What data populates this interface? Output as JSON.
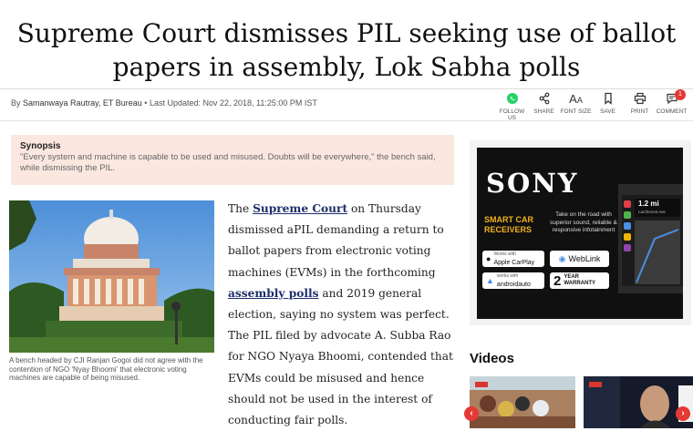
{
  "headline": {
    "line1": "Supreme Court dismisses PIL seeking use of ballot",
    "line2": "papers in assembly, Lok Sabha polls"
  },
  "byline": {
    "prefix": "By",
    "author": "Samanwaya Rautray, ET Bureau",
    "separator": "•",
    "updated": "Last Updated: Nov 22, 2018, 11:25:00 PM IST"
  },
  "actions": [
    {
      "label": "FOLLOW US",
      "icon": "whatsapp-icon"
    },
    {
      "label": "SHARE",
      "icon": "share-icon"
    },
    {
      "label": "FONT SIZE",
      "icon": "font-size-icon"
    },
    {
      "label": "SAVE",
      "icon": "bookmark-icon"
    },
    {
      "label": "PRINT",
      "icon": "print-icon"
    },
    {
      "label": "COMMENT",
      "icon": "comment-icon",
      "badge": "1"
    }
  ],
  "synopsis": {
    "title": "Synopsis",
    "text": "\"Every system and machine is capable to be used and misused. Doubts will be everywhere,\" the bench said, while dismissing the PIL."
  },
  "image_caption": "A bench headed by CJI Ranjan Gogoi did not agree with the contention of NGO 'Nyay Bhoomi' that electronic voting machines are capable of being misused.",
  "article": {
    "p1_a": "The ",
    "link1": "Supreme Court",
    "p1_b": " on Thursday dismissed aPIL demanding a return to ballot papers from electronic voting machines (EVMs) in the forthcoming ",
    "link2": "assembly polls",
    "p1_c": " and 2019 general election, saying no system was perfect. The PIL filed by advocate A. Subba Rao for NGO Nyaya Bhoomi, contended that EVMs could be misused and hence should not be used in the interest of conducting fair polls."
  },
  "ad": {
    "brand": "SONY",
    "headline": "SMART CAR RECEIVERS",
    "tagline": "Take on the road with superior sound, reliable & responsive infotainment",
    "apple_small": "Works with",
    "apple": "Apple CarPlay",
    "weblink": "WebLink",
    "android_small": "works with",
    "android": "androidauto",
    "warranty_num": "2",
    "warranty": "YEAR WARRANTY",
    "screen_value": "1.2 mi",
    "screen_street": "Larchmont Ave"
  },
  "videos": {
    "title": "Videos",
    "prev_icon": "chevron-left-icon",
    "next_icon": "chevron-right-icon"
  },
  "colors": {
    "synopsis_bg": "#fbe7e0",
    "link": "#1d2f6b",
    "badge": "#e53935",
    "ad_accent": "#f2b21c"
  }
}
